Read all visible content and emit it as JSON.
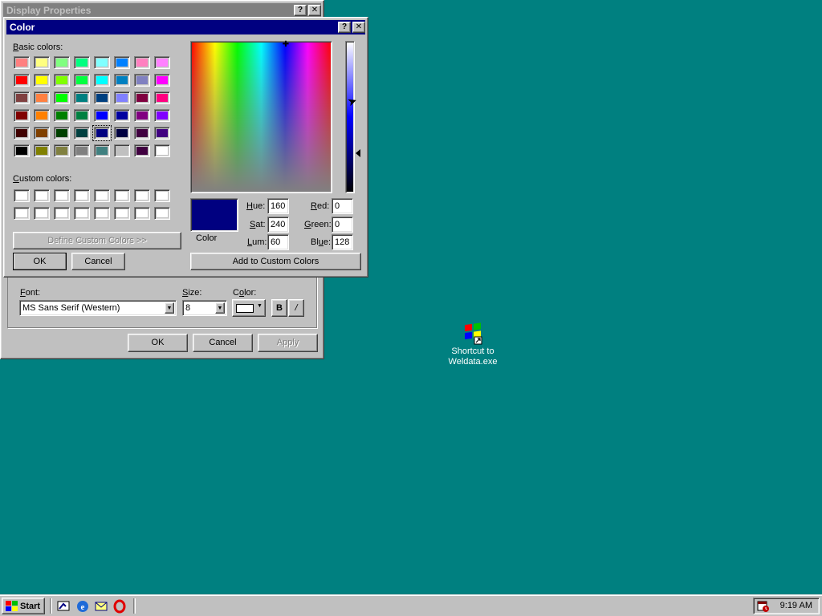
{
  "display_properties": {
    "title": "Display Properties",
    "help_btn": "?",
    "close_btn": "✕",
    "font_label": "Font:",
    "font_value": "MS Sans Serif (Western)",
    "size_label": "Size:",
    "size_value": "8",
    "color_label": "Color:",
    "bold_label": "B",
    "italic_label": "/",
    "ok": "OK",
    "cancel": "Cancel",
    "apply": "Apply"
  },
  "color_dialog": {
    "title": "Color",
    "help_btn": "?",
    "close_btn": "✕",
    "basic_colors_label": "Basic colors:",
    "custom_colors_label": "Custom colors:",
    "define_custom": "Define Custom Colors >>",
    "ok": "OK",
    "cancel": "Cancel",
    "add_custom": "Add to Custom Colors",
    "color_solid_label": "Color",
    "hue_label": "Hue:",
    "hue_value": "160",
    "sat_label": "Sat:",
    "sat_value": "240",
    "lum_label": "Lum:",
    "lum_value": "60",
    "red_label": "Red:",
    "red_value": "0",
    "green_label": "Green:",
    "green_value": "0",
    "blue_label": "Blue:",
    "blue_value": "128",
    "selected_color": "#000080",
    "selected_swatch_index": 36,
    "basic_colors": [
      "#ff8080",
      "#ffff80",
      "#80ff80",
      "#00ff80",
      "#80ffff",
      "#0080ff",
      "#ff80c0",
      "#ff80ff",
      "#ff0000",
      "#ffff00",
      "#80ff00",
      "#00ff40",
      "#00ffff",
      "#0080c0",
      "#8080c0",
      "#ff00ff",
      "#804040",
      "#ff8040",
      "#00ff00",
      "#008080",
      "#004080",
      "#8080ff",
      "#800040",
      "#ff0080",
      "#800000",
      "#ff8000",
      "#008000",
      "#008040",
      "#0000ff",
      "#0000a0",
      "#800080",
      "#8000ff",
      "#400000",
      "#804000",
      "#004000",
      "#004040",
      "#000080",
      "#000040",
      "#400040",
      "#400080",
      "#000000",
      "#808000",
      "#808040",
      "#808080",
      "#408080",
      "#c0c0c0",
      "#400040",
      "#ffffff"
    ],
    "custom_colors": [
      "#ffffff",
      "#ffffff",
      "#ffffff",
      "#ffffff",
      "#ffffff",
      "#ffffff",
      "#ffffff",
      "#ffffff",
      "#ffffff",
      "#ffffff",
      "#ffffff",
      "#ffffff",
      "#ffffff",
      "#ffffff",
      "#ffffff",
      "#ffffff"
    ]
  },
  "desktop": {
    "background": "#008080",
    "icon_label_1": "Shortcut to",
    "icon_label_2": "Weldata.exe"
  },
  "taskbar": {
    "start_label": "Start",
    "clock": "9:19 AM"
  }
}
